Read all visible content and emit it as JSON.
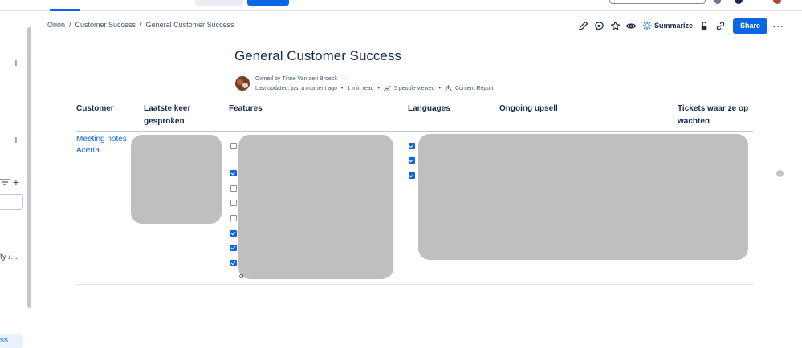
{
  "breadcrumb": {
    "items": [
      "Orion",
      "Customer Success",
      "General Customer Success"
    ]
  },
  "toolbar": {
    "summarize_label": "Summarize",
    "share_label": "Share",
    "more_label": "···"
  },
  "page": {
    "title": "General Customer Success",
    "owner_text": "Owned by Tinne Van den Broeck",
    "owner_more": "···",
    "last_updated": "Last updated: just a moment ago",
    "read_time": "1 min read",
    "people_viewed": "5 people viewed",
    "content_report": "Content Report"
  },
  "table": {
    "headers": {
      "customer": "Customer",
      "laatste_line1": "Laatste keer",
      "laatste_line2": "gesproken",
      "features": "Features",
      "languages": "Languages",
      "upsell": "Ongoing upsell",
      "tickets_line1": "Tickets waar ze op",
      "tickets_line2": "wachten"
    },
    "row": {
      "customer_link_line1": "Meeting notes",
      "customer_link_line2": "Acerta"
    },
    "features_checks": [
      false,
      true,
      false,
      false,
      false,
      true,
      true,
      true
    ],
    "languages_checks": [
      true,
      true,
      true
    ],
    "feature_footer_partial": "O"
  },
  "sidebar": {
    "truncated_text": "ty /...",
    "active_item": "ss"
  },
  "colors": {
    "accent": "#0c66e4",
    "redaction": "#bfbfbf"
  }
}
